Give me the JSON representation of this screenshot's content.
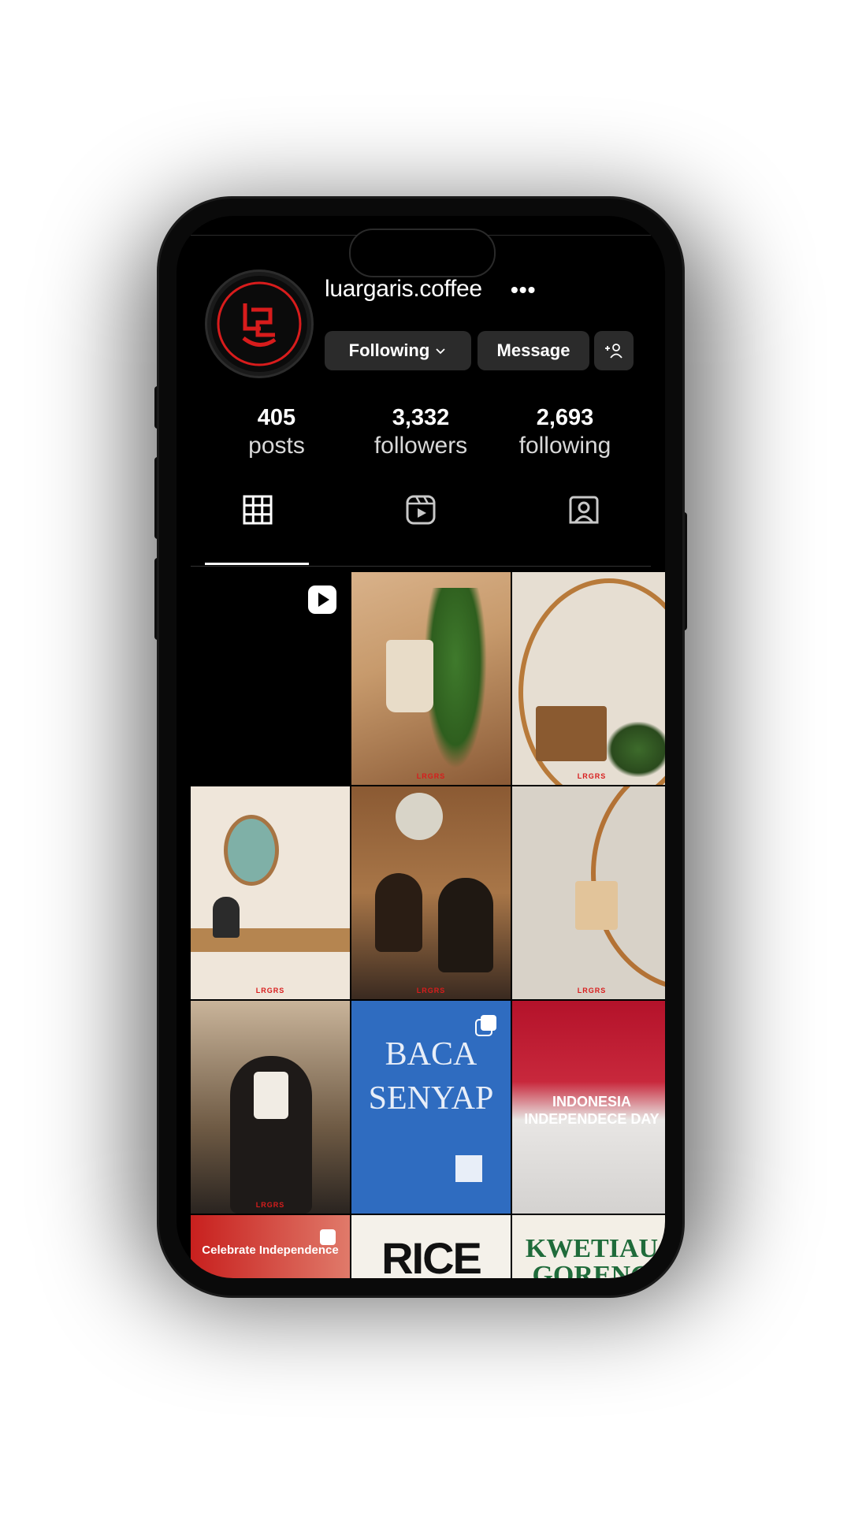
{
  "profile": {
    "username": "luargaris.coffee",
    "more_icon": "more-horizontal-icon",
    "avatar_icon": "luargaris-logo"
  },
  "actions": {
    "following_label": "Following",
    "following_chevron": "chevron-down-icon",
    "message_label": "Message",
    "add_user_icon": "add-user-icon"
  },
  "stats": {
    "posts": {
      "value": "405",
      "label": "posts"
    },
    "followers": {
      "value": "3,332",
      "label": "followers"
    },
    "following": {
      "value": "2,693",
      "label": "following"
    }
  },
  "tabs": [
    {
      "name": "posts-grid",
      "icon": "grid-icon",
      "active": true
    },
    {
      "name": "reels",
      "icon": "reels-icon",
      "active": false
    },
    {
      "name": "tagged",
      "icon": "tagged-user-icon",
      "active": false
    }
  ],
  "posts": {
    "post_mark": "LRGRS",
    "baca_title_1": "BACA",
    "baca_title_2": "SENYAP",
    "indonesia_line_1": "INDONESIA",
    "indonesia_line_2": "INDEPENDECE DAY",
    "celebrate_text": "Celebrate Independence",
    "rice_text": "RICE",
    "kwetiau_line_1": "KWETIAU",
    "kwetiau_line_2": "GORENG"
  },
  "colors": {
    "background": "#000000",
    "button": "#2b2b2b",
    "brand_red": "#d81c1c",
    "baca_blue": "#2f6cc0",
    "kwetiau_green": "#1f6b3a"
  }
}
